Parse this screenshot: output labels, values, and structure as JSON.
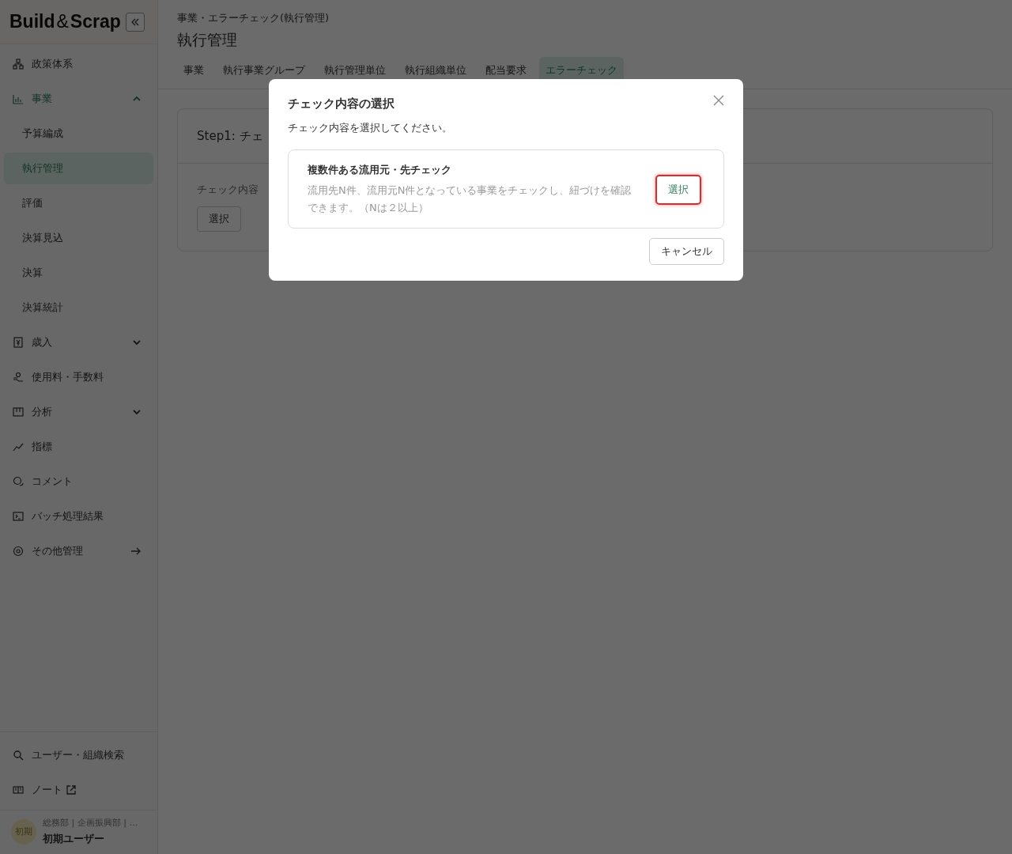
{
  "sidebar": {
    "logo": [
      "Build",
      "&",
      "Scrap"
    ],
    "items": [
      {
        "label": "政策体系",
        "kind": "plain",
        "selected": false
      },
      {
        "label": "事業",
        "kind": "expandable",
        "expanded": true,
        "selected": true,
        "children": [
          {
            "label": "予算編成",
            "selected": false
          },
          {
            "label": "執行管理",
            "selected": true
          },
          {
            "label": "評価",
            "selected": false
          },
          {
            "label": "決算見込",
            "selected": false
          },
          {
            "label": "決算",
            "selected": false
          },
          {
            "label": "決算統計",
            "selected": false
          }
        ]
      },
      {
        "label": "歳入",
        "kind": "expandable",
        "expanded": false,
        "selected": false
      },
      {
        "label": "使用料・手数料",
        "kind": "plain",
        "selected": false
      },
      {
        "label": "分析",
        "kind": "expandable",
        "expanded": false,
        "selected": false
      },
      {
        "label": "指標",
        "kind": "plain",
        "selected": false
      },
      {
        "label": "コメント",
        "kind": "plain",
        "selected": false
      },
      {
        "label": "バッチ処理結果",
        "kind": "plain",
        "selected": false
      },
      {
        "label": "その他管理",
        "kind": "link",
        "selected": false
      }
    ],
    "bottom_items": [
      {
        "label": "ユーザー・組織検索",
        "kind": "plain"
      },
      {
        "label": "ノート",
        "kind": "external"
      }
    ],
    "user": {
      "avatar": "初期",
      "org": "総務部 | 企画振興部 | …",
      "name": "初期ユーザー"
    }
  },
  "header": {
    "breadcrumb": "事業・エラーチェック(執行管理)",
    "title": "執行管理"
  },
  "tabs": [
    {
      "label": "事業",
      "selected": false
    },
    {
      "label": "執行事業グループ",
      "selected": false
    },
    {
      "label": "執行管理単位",
      "selected": false
    },
    {
      "label": "執行組織単位",
      "selected": false
    },
    {
      "label": "配当要求",
      "selected": false
    },
    {
      "label": "エラーチェック",
      "selected": true
    }
  ],
  "step_card": {
    "title": "Step1: チェ",
    "field_label": "チェック内容",
    "button": "選択"
  },
  "modal": {
    "title": "チェック内容の選択",
    "description": "チェック内容を選択してください。",
    "options": [
      {
        "title": "複数件ある流用元・先チェック",
        "description": "流用先N件、流用元N件となっている事業をチェックし、紐づけを確認できます。（Nは２以上）",
        "button": "選択",
        "highlighted": true
      }
    ],
    "cancel": "キャンセル"
  }
}
